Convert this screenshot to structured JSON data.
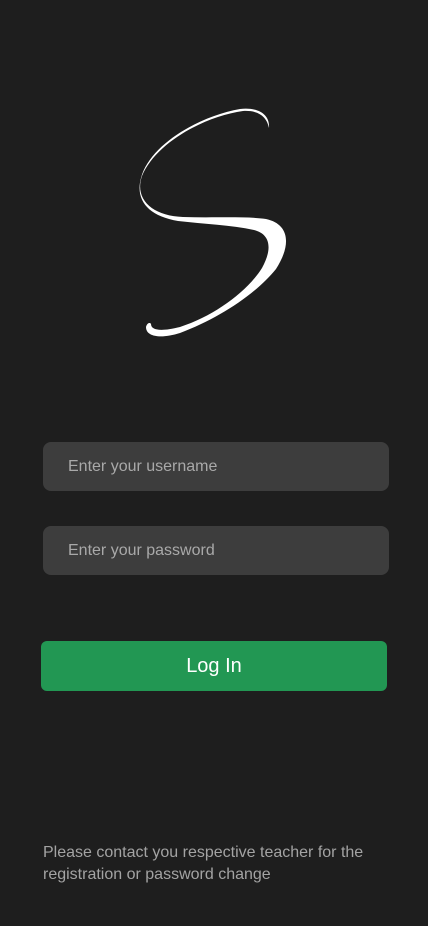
{
  "app": {
    "logo_letter": "S",
    "logo_color": "#ffffff"
  },
  "login": {
    "username_placeholder": "Enter your username",
    "username_value": "",
    "password_placeholder": "Enter your password",
    "password_value": "",
    "login_label": "Log In",
    "accent_color": "#229753"
  },
  "footer": {
    "help_text": "Please contact you respective teacher for the registration or password change"
  }
}
